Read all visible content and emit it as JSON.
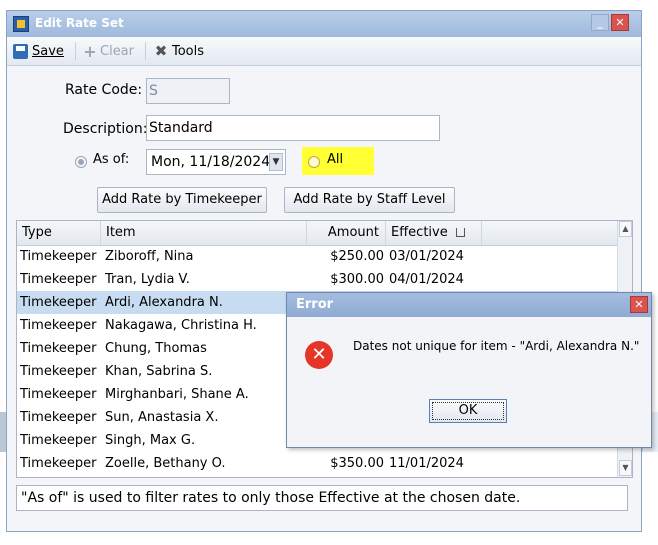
{
  "window": {
    "title": "Edit Rate Set"
  },
  "toolbar": {
    "save_label": "Save",
    "clear_label": "Clear",
    "tools_label": "Tools"
  },
  "form": {
    "rate_code_label": "Rate Code:",
    "rate_code_value": "S",
    "description_label": "Description:",
    "description_value": "Standard",
    "as_of_label": "As of:",
    "as_of_value": "Mon, 11/18/2024",
    "all_label": "All",
    "add_by_timekeeper_label": "Add Rate by Timekeeper",
    "add_by_staff_level_label": "Add Rate by Staff Level"
  },
  "grid": {
    "columns": {
      "type": "Type",
      "item": "Item",
      "amount": "Amount",
      "effective": "Effective"
    },
    "rows": [
      {
        "type": "Timekeeper",
        "item": "Ziboroff, Nina",
        "amount": "$250.00",
        "effective": "03/01/2024"
      },
      {
        "type": "Timekeeper",
        "item": "Tran, Lydia V.",
        "amount": "$300.00",
        "effective": "04/01/2024"
      },
      {
        "type": "Timekeeper",
        "item": "Ardi, Alexandra N.",
        "amount": "",
        "effective": ""
      },
      {
        "type": "Timekeeper",
        "item": "Nakagawa, Christina H.",
        "amount": "",
        "effective": ""
      },
      {
        "type": "Timekeeper",
        "item": "Chung, Thomas",
        "amount": "",
        "effective": ""
      },
      {
        "type": "Timekeeper",
        "item": "Khan, Sabrina S.",
        "amount": "",
        "effective": ""
      },
      {
        "type": "Timekeeper",
        "item": "Mirghanbari, Shane A.",
        "amount": "",
        "effective": ""
      },
      {
        "type": "Timekeeper",
        "item": "Sun, Anastasia X.",
        "amount": "",
        "effective": ""
      },
      {
        "type": "Timekeeper",
        "item": "Singh, Max G.",
        "amount": "",
        "effective": ""
      },
      {
        "type": "Timekeeper",
        "item": "Zoelle, Bethany O.",
        "amount": "$350.00",
        "effective": "11/01/2024"
      }
    ]
  },
  "status_text": "\"As of\" is used to filter rates to only those Effective at the chosen date.",
  "error_dialog": {
    "title": "Error",
    "message": "Dates not unique for item - \"Ardi, Alexandra N.\"",
    "ok_label": "OK"
  },
  "colors": {
    "highlight": "#ffff33",
    "selected_row": "#c7dbf1",
    "error_icon": "#e53528",
    "titlebar": "#9fb9dc"
  }
}
